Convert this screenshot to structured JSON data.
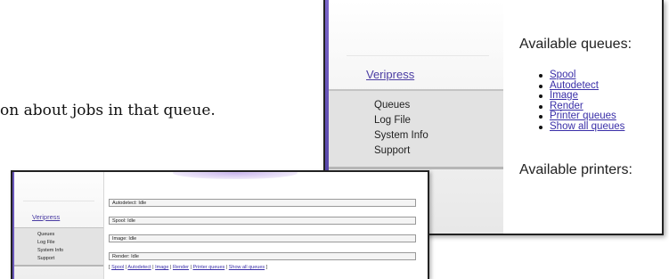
{
  "document": {
    "visible_text": "on about jobs in that queue."
  },
  "large_screenshot": {
    "sidebar": {
      "brand": "Veripress",
      "menu": [
        "Queues",
        "Log File",
        "System Info",
        "Support"
      ]
    },
    "main": {
      "queues_heading": "Available queues:",
      "queues": [
        "Spool",
        "Autodetect",
        "Image",
        "Render",
        "Printer queues",
        "Show all queues"
      ],
      "printers_heading": "Available printers:"
    }
  },
  "small_screenshot": {
    "sidebar": {
      "brand": "Veripress",
      "menu": [
        "Queues",
        "Log File",
        "System Info",
        "Support"
      ]
    },
    "main": {
      "statuses": [
        "Autodetect: Idle",
        "Spool: Idle",
        "Image: Idle",
        "Render: Idle"
      ],
      "link_bar": {
        "open": "[",
        "separator": "|",
        "close": "]",
        "links": [
          "Spool",
          "Autodetect",
          "Image",
          "Render",
          "Printer queues",
          "Show all queues"
        ]
      }
    }
  },
  "colors": {
    "link": "#3a2fa8",
    "brand": "#4b3da3",
    "accent_purple": "#6b58bd"
  }
}
